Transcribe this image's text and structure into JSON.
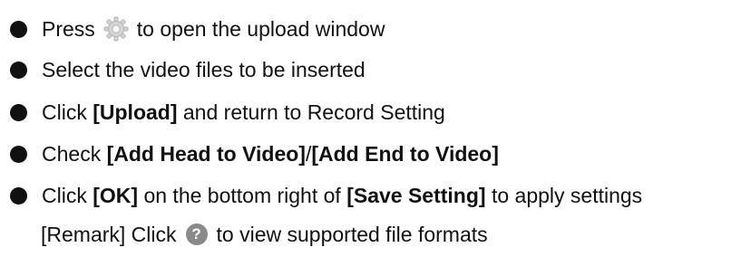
{
  "steps": [
    {
      "prefix": "Press",
      "icon": "gear-icon",
      "suffix": "to open the upload window"
    },
    {
      "text": "Select the video files to be inserted"
    },
    {
      "prefix": "Click ",
      "bold": "[Upload]",
      "suffix": " and return to Record Setting"
    },
    {
      "prefix": "Check ",
      "bold1": "[Add Head to Video]",
      "sep": "/",
      "bold2": "[Add End to Video]"
    },
    {
      "prefix": "Click ",
      "bold1": "[OK]",
      "mid": " on the bottom right of ",
      "bold2": "[Save Setting]",
      "suffix": " to apply settings"
    }
  ],
  "remark": {
    "prefix": "[Remark] Click",
    "icon": "help-icon",
    "icon_glyph": "?",
    "suffix": "to view supported file formats"
  }
}
